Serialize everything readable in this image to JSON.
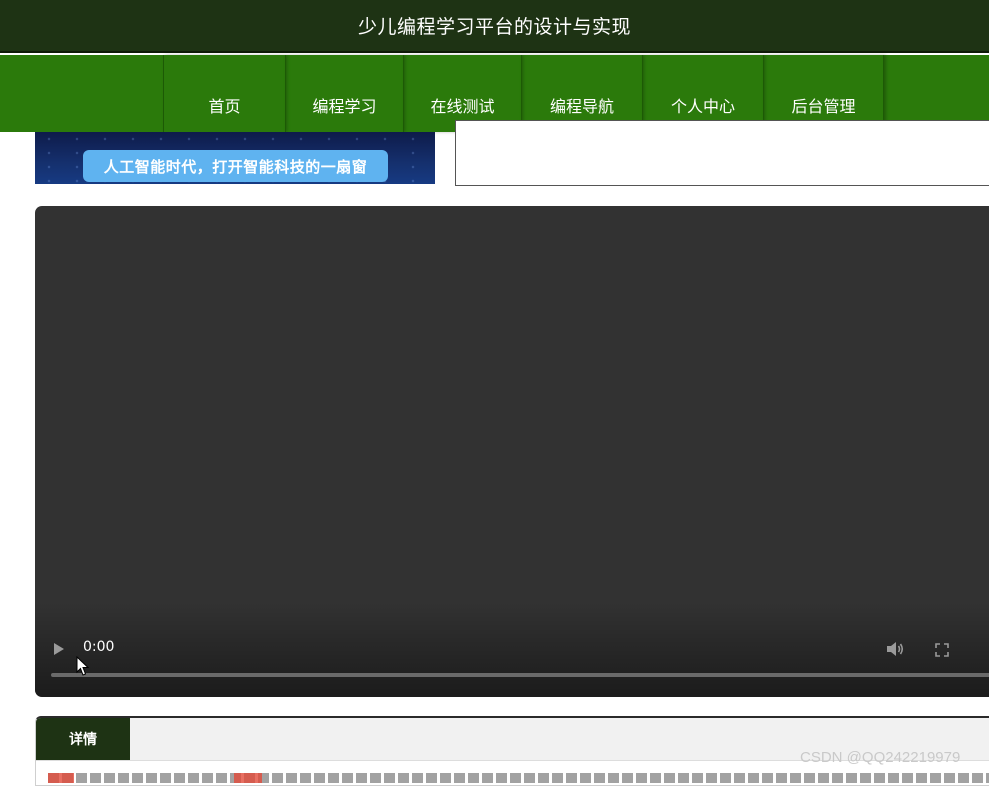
{
  "header": {
    "title": "少儿编程学习平台的设计与实现"
  },
  "nav": {
    "items": [
      {
        "label": "首页"
      },
      {
        "label": "编程学习"
      },
      {
        "label": "在线测试"
      },
      {
        "label": "编程导航"
      },
      {
        "label": "个人中心"
      },
      {
        "label": "后台管理"
      }
    ]
  },
  "banner": {
    "caption": "人工智能时代，打开智能科技的一扇窗"
  },
  "video": {
    "current_time": "0:00",
    "icons": [
      "play-icon",
      "volume-icon",
      "fullscreen-icon"
    ],
    "progress": 0
  },
  "details": {
    "tab_label": "详情"
  },
  "watermark": {
    "text": "CSDN @QQ242219979"
  },
  "colors": {
    "header_bg": "#1e3314",
    "nav_bg": "#2b7a0b",
    "video_bg": "#323232",
    "banner_pill": "#5fb3f0"
  }
}
